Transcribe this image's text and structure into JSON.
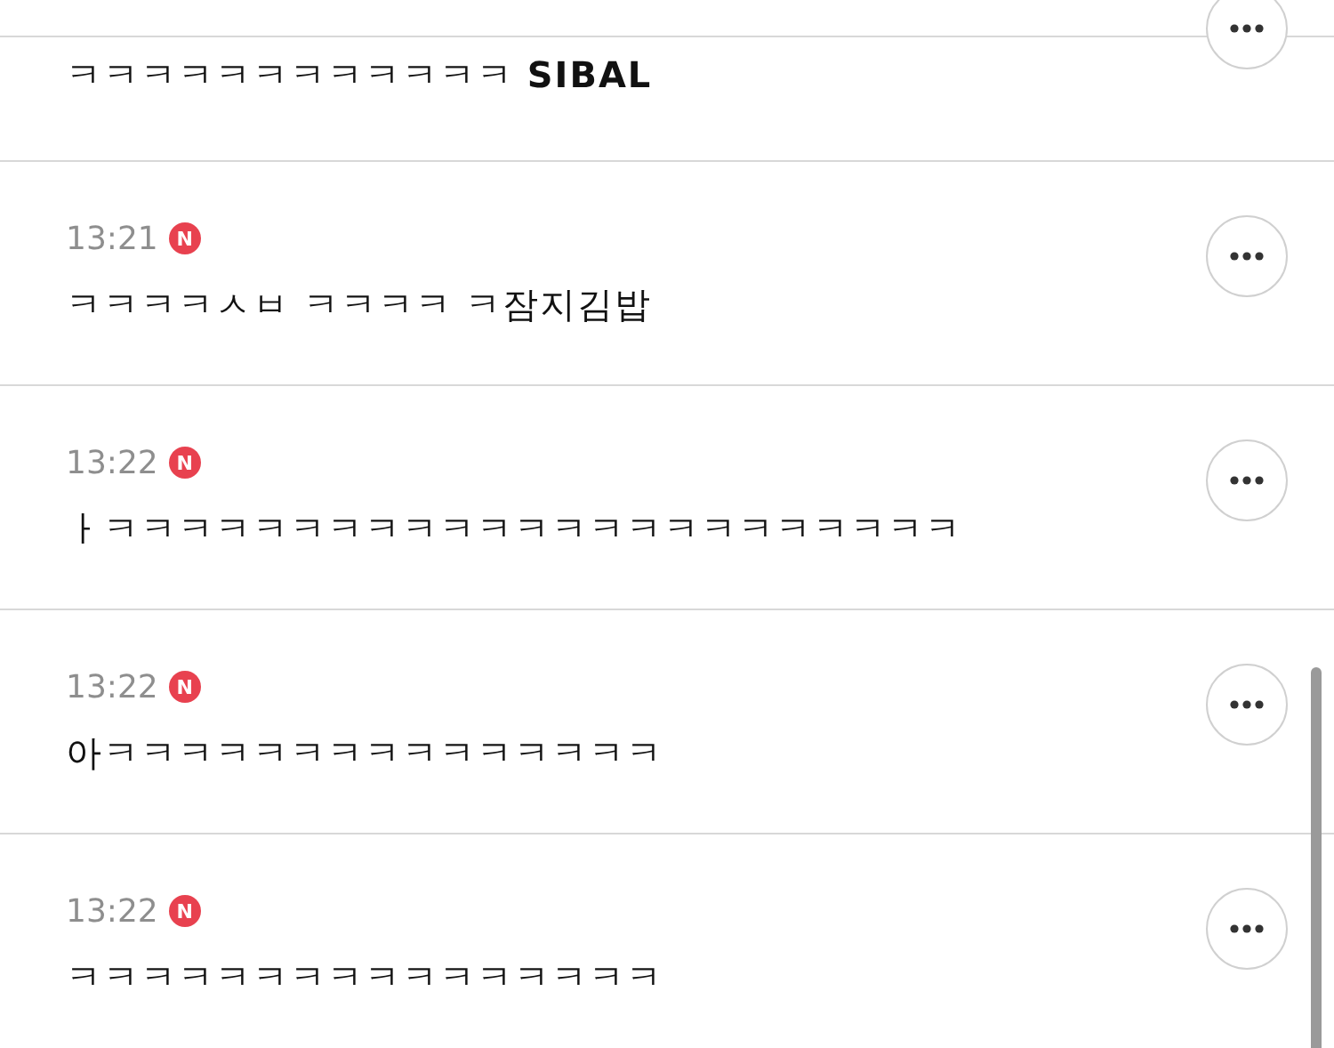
{
  "comments": [
    {
      "text": "ㅋㅋㅋㅋㅋㅋㅋㅋㅋㅋㅋㅋ **SIBAL**"
    },
    {
      "time": "13:21",
      "badge": "N",
      "text": "ㅋㅋㅋㅋㅅㅂ ㅋㅋㅋㅋ ㅋ잠지김밥"
    },
    {
      "time": "13:22",
      "badge": "N",
      "text": "ㅏㅋㅋㅋㅋㅋㅋㅋㅋㅋㅋㅋㅋㅋㅋㅋㅋㅋㅋㅋㅋㅋㅋㅋ"
    },
    {
      "time": "13:22",
      "badge": "N",
      "text": "아ㅋㅋㅋㅋㅋㅋㅋㅋㅋㅋㅋㅋㅋㅋㅋ"
    },
    {
      "time": "13:22",
      "badge": "N",
      "text": "ㅋㅋㅋㅋㅋㅋㅋㅋㅋㅋㅋㅋㅋㅋㅋㅋ"
    }
  ]
}
